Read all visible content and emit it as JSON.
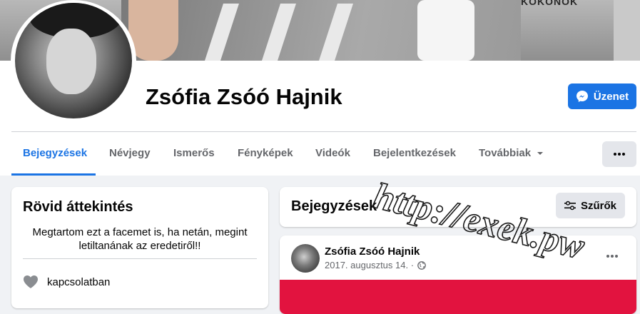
{
  "cover": {
    "sign_text": "KOKONOK"
  },
  "profile": {
    "name": "Zsófia Zsóó Hajnik"
  },
  "actions": {
    "message_label": "Üzenet",
    "more_label": "…"
  },
  "tabs": [
    {
      "label": "Bejegyzések",
      "active": true
    },
    {
      "label": "Névjegy"
    },
    {
      "label": "Ismerős"
    },
    {
      "label": "Fényképek"
    },
    {
      "label": "Videók"
    },
    {
      "label": "Bejelentkezések"
    },
    {
      "label": "Továbbiak"
    }
  ],
  "intro": {
    "title": "Rövid áttekintés",
    "bio": "Megtartom ezt a facemet is, ha netán, megint letiltanának az eredetiről!!",
    "relationship": "kapcsolatban"
  },
  "posts_header": {
    "title": "Bejegyzések",
    "filter_label": "Szűrők"
  },
  "post": {
    "author": "Zsófia Zsóó Hajnik",
    "date": "2017. augusztus 14. ·"
  },
  "watermark": {
    "text": "http://exek.pw"
  },
  "colors": {
    "accent": "#1b74e4",
    "post_image": "#e2133f",
    "background": "#f0f2f5"
  },
  "icons": [
    "messenger-icon",
    "chevron-down-icon",
    "more-dots-icon",
    "heart-icon",
    "filter-icon",
    "globe-icon"
  ]
}
